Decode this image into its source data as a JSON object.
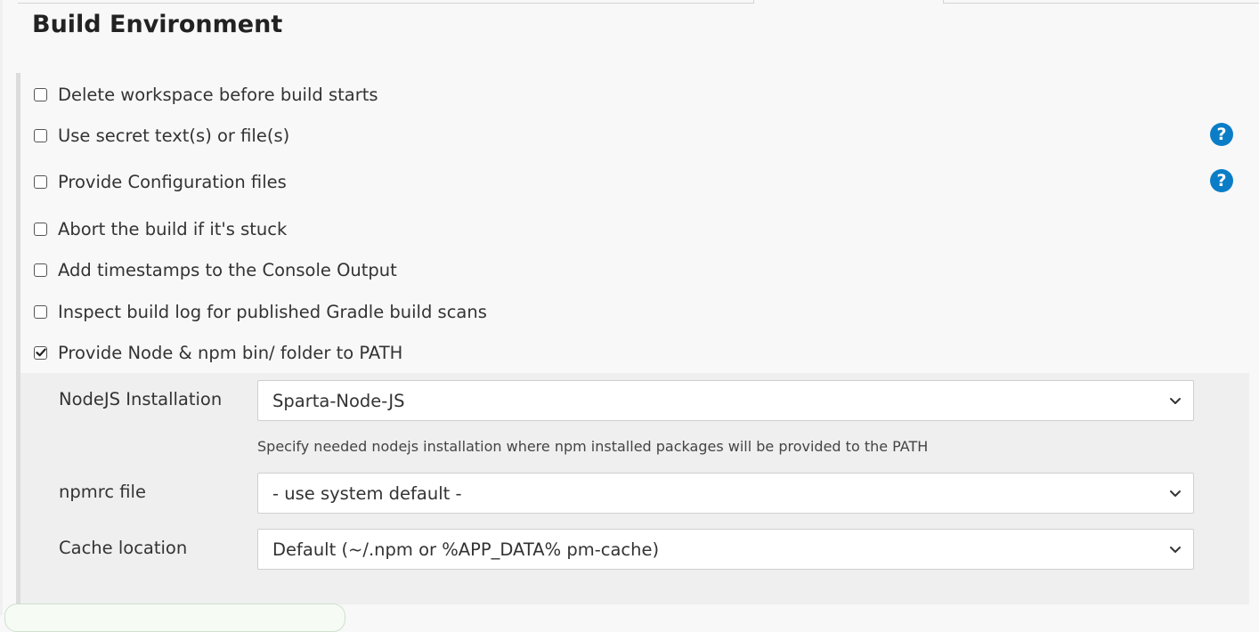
{
  "section": {
    "title": "Build Environment"
  },
  "options": [
    {
      "label": "Delete workspace before build starts",
      "checked": false,
      "help": false
    },
    {
      "label": "Use secret text(s) or file(s)",
      "checked": false,
      "help": true
    },
    {
      "label": "Provide Configuration files",
      "checked": false,
      "help": true
    },
    {
      "label": "Abort the build if it's stuck",
      "checked": false,
      "help": false
    },
    {
      "label": "Add timestamps to the Console Output",
      "checked": false,
      "help": false
    },
    {
      "label": "Inspect build log for published Gradle build scans",
      "checked": false,
      "help": false
    },
    {
      "label": "Provide Node & npm bin/ folder to PATH",
      "checked": true,
      "help": false
    }
  ],
  "help_icon_glyph": "?",
  "node_settings": {
    "nodejs_installation": {
      "label": "NodeJS Installation",
      "value": "Sparta-Node-JS",
      "help_text": "Specify needed nodejs installation where npm installed packages will be provided to the PATH"
    },
    "npmrc_file": {
      "label": "npmrc file",
      "value": "- use system default -"
    },
    "cache_location": {
      "label": "Cache location",
      "value": "Default (~/.npm or %APP_DATA% pm-cache)"
    }
  },
  "colors": {
    "help_icon": "#0b7dc7",
    "text": "#333333",
    "nested_bg": "#efefef"
  }
}
